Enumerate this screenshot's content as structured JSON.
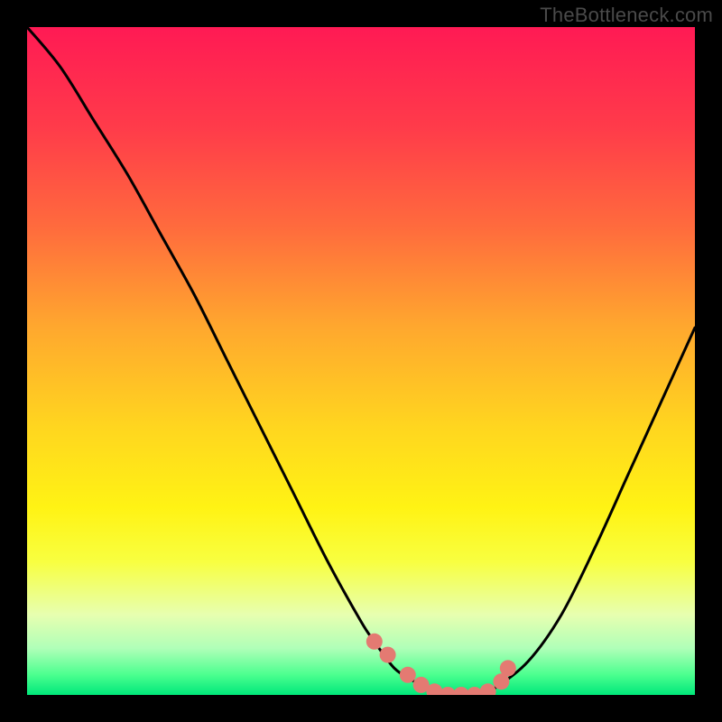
{
  "attribution": "TheBottleneck.com",
  "colors": {
    "background": "#000000",
    "gradient_top": "#ff1a54",
    "gradient_bottom": "#00e77a",
    "curve_stroke": "#000000",
    "marker_fill": "#e47a72"
  },
  "chart_data": {
    "type": "line",
    "title": "",
    "xlabel": "",
    "ylabel": "",
    "xlim": [
      0,
      100
    ],
    "ylim": [
      0,
      100
    ],
    "x": [
      0,
      5,
      10,
      15,
      20,
      25,
      30,
      35,
      40,
      45,
      50,
      52,
      55,
      58,
      60,
      62,
      65,
      68,
      70,
      75,
      80,
      85,
      90,
      95,
      100
    ],
    "y": [
      100,
      94,
      86,
      78,
      69,
      60,
      50,
      40,
      30,
      20,
      11,
      8,
      4,
      2,
      1,
      0,
      0,
      0,
      1,
      5,
      12,
      22,
      33,
      44,
      55
    ],
    "markers": {
      "x": [
        52,
        54,
        57,
        59,
        61,
        63,
        65,
        67,
        69,
        71,
        72
      ],
      "y": [
        8,
        6,
        3,
        1.5,
        0.5,
        0,
        0,
        0,
        0.5,
        2,
        4
      ]
    },
    "annotations": []
  }
}
